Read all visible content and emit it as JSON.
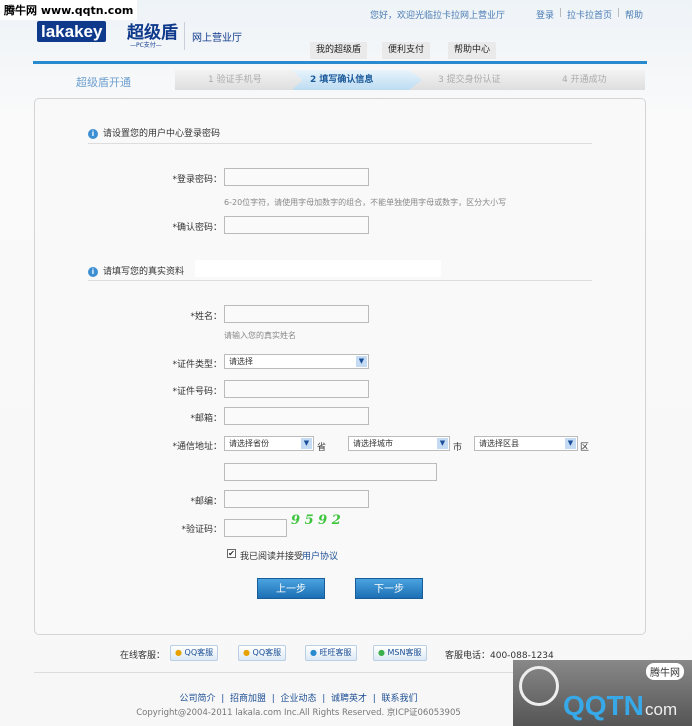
{
  "watermark": "腾牛网 www.qqtn.com",
  "header": {
    "logo_en": "lakakey",
    "logo_cn": "超级盾",
    "logo_sub": "—PC支付—",
    "site": "网上营业厅",
    "welcome": "您好，欢迎光临拉卡拉网上营业厅",
    "links": [
      "登录",
      "拉卡拉首页",
      "帮助"
    ],
    "nav": [
      "我的超级盾",
      "便利支付",
      "帮助中心"
    ]
  },
  "steps": {
    "title": "超级盾开通",
    "items": [
      "1 验证手机号",
      "2 填写确认信息",
      "3 提交身份认证",
      "4 开通成功"
    ],
    "active_index": 1
  },
  "section1": {
    "title": "请设置您的用户中心登录密码",
    "password_label": "*登录密码：",
    "password_hint": "6-20位字符，请使用字母加数字的组合，不能单独使用字母或数字，区分大小写",
    "confirm_label": "*确认密码："
  },
  "section2": {
    "title": "请填写您的真实资料",
    "name_label": "*姓名：",
    "name_hint": "请输入您的真实姓名",
    "idtype_label": "*证件类型：",
    "idtype_value": "请选择",
    "idno_label": "*证件号码：",
    "email_label": "*邮箱：",
    "address_label": "*通信地址：",
    "province": "请选择省份",
    "province_unit": "省",
    "city": "请选择城市",
    "city_unit": "市",
    "district": "请选择区县",
    "district_unit": "区",
    "zip_label": "*邮编：",
    "captcha_label": "*验证码：",
    "captcha": "9 5 9 2",
    "agree_text": "我已阅读并接受",
    "agree_link": "用户协议",
    "agree_checked": true,
    "prev": "上一步",
    "next": "下一步"
  },
  "service": {
    "label": "在线客服：",
    "buttons": [
      "QQ客服",
      "QQ客服",
      "旺旺客服",
      "MSN客服"
    ],
    "phone": "客服电话：400-088-1234"
  },
  "footer": {
    "links": [
      "公司简介",
      "招商加盟",
      "企业动态",
      "诚聘英才",
      "联系我们"
    ],
    "copyright": "Copyright@2004-2011 lakala.com Inc.All Rights Reserved. 京ICP证06053905"
  },
  "corner_logo": {
    "brand": "QQTN",
    "suffix": "com",
    "badge": "腾牛网"
  },
  "colors": {
    "accent": "#2a8ad0",
    "link": "#1d4f94",
    "captcha": "#3cc43c"
  }
}
